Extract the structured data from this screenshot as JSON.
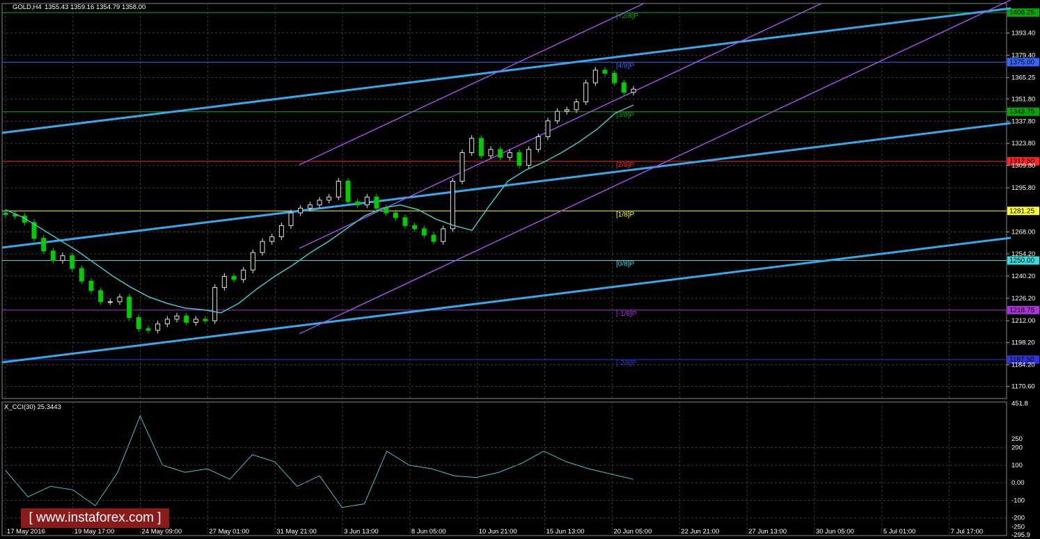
{
  "header": {
    "symbol": "GOLD,H4",
    "ohlc": "1355.43 1359.16 1354.79 1358.00"
  },
  "indicator": {
    "label": "X_CCI(30) 25.3443"
  },
  "watermark": {
    "text": "[ www.instaforex.com ]"
  },
  "colors": {
    "bg": "#000000",
    "grid": "#3a3a3a",
    "bull": "#e6e6e6",
    "bear": "#00cc00",
    "ma": "#40c8c8",
    "trend_blue": "#33aaee",
    "channel": "#a050e0",
    "cci": "#40c8c8"
  },
  "chart_data": {
    "type": "candlestick",
    "title": "GOLD,H4",
    "x_labels": [
      "17 May 2016",
      "19 May 17:00",
      "24 May 09:00",
      "27 May 01:00",
      "31 May 21:00",
      "3 Jun 13:00",
      "8 Jun 05:00",
      "10 Jun 21:00",
      "15 Jun 13:00",
      "20 Jun 05:00",
      "22 Jun 21:00",
      "27 Jun 13:00",
      "30 Jun 05:00",
      "5 Jul 01:00",
      "7 Jul 17:00"
    ],
    "price_ticks": [
      1393.4,
      1379.4,
      1365.25,
      1351.8,
      1337.8,
      1323.8,
      1309.8,
      1295.8,
      1268.0,
      1254.2,
      1240.2,
      1226.2,
      1212.0,
      1198.2,
      1184.2,
      1170.6
    ],
    "current_price": 1358.0,
    "murrey_levels": [
      {
        "label": "[+2/8]P",
        "price": 1406.25,
        "tag": "1406.25",
        "color": "#00aa00"
      },
      {
        "label": "[4/8]P",
        "price": 1375.0,
        "tag": "1375.00",
        "color": "#3366ff"
      },
      {
        "label": "[3/8]P",
        "price": 1343.75,
        "tag": "1343.75",
        "color": "#00aa00"
      },
      {
        "label": "[2/8]P",
        "price": 1312.5,
        "tag": "1312.50",
        "color": "#ff2222"
      },
      {
        "label": "[1/8]P",
        "price": 1281.25,
        "tag": "1281.25",
        "color": "#ffff33"
      },
      {
        "label": "[0/8]P",
        "price": 1250.0,
        "tag": "1250.00",
        "color": "#33dddd"
      },
      {
        "label": "[-1/8]P",
        "price": 1218.75,
        "tag": "1218.75",
        "color": "#aa33dd"
      },
      {
        "label": "[-2/8]P",
        "price": 1187.5,
        "tag": "1187.50",
        "color": "#3333dd"
      }
    ],
    "series": [
      {
        "name": "candles_close_approx",
        "values": [
          1279,
          1278,
          1274,
          1264,
          1256,
          1250,
          1253,
          1245,
          1237,
          1231,
          1224,
          1224,
          1227,
          1214,
          1207,
          1206,
          1210,
          1213,
          1215,
          1211,
          1213,
          1212,
          1233,
          1240,
          1238,
          1244,
          1255,
          1262,
          1265,
          1272,
          1280,
          1283,
          1285,
          1288,
          1290,
          1300,
          1287,
          1285,
          1290,
          1283,
          1280,
          1277,
          1272,
          1270,
          1266,
          1262,
          1270,
          1300,
          1318,
          1327,
          1316,
          1320,
          1315,
          1318,
          1310,
          1320,
          1328,
          1338,
          1344,
          1345,
          1350,
          1362,
          1370,
          1368,
          1362,
          1356,
          1358
        ]
      },
      {
        "name": "ma",
        "values": [
          1282,
          1277,
          1270,
          1263,
          1256,
          1248,
          1240,
          1233,
          1227,
          1223,
          1220,
          1219,
          1217,
          1223,
          1232,
          1240,
          1247,
          1255,
          1262,
          1270,
          1278,
          1283,
          1285,
          1282,
          1276,
          1272,
          1269,
          1285,
          1300,
          1307,
          1312,
          1318,
          1325,
          1333,
          1343,
          1348
        ]
      },
      {
        "name": "cci",
        "values": [
          70,
          -80,
          -20,
          -40,
          -130,
          60,
          380,
          100,
          60,
          80,
          20,
          160,
          120,
          -20,
          40,
          -140,
          -120,
          180,
          100,
          80,
          40,
          30,
          60,
          110,
          180,
          120,
          80,
          50,
          20
        ]
      }
    ],
    "cci_ticks": [
      451.8,
      250,
      200,
      100,
      0,
      -100,
      -200,
      -250,
      -295.9
    ],
    "ylim": [
      1163,
      1412
    ]
  }
}
